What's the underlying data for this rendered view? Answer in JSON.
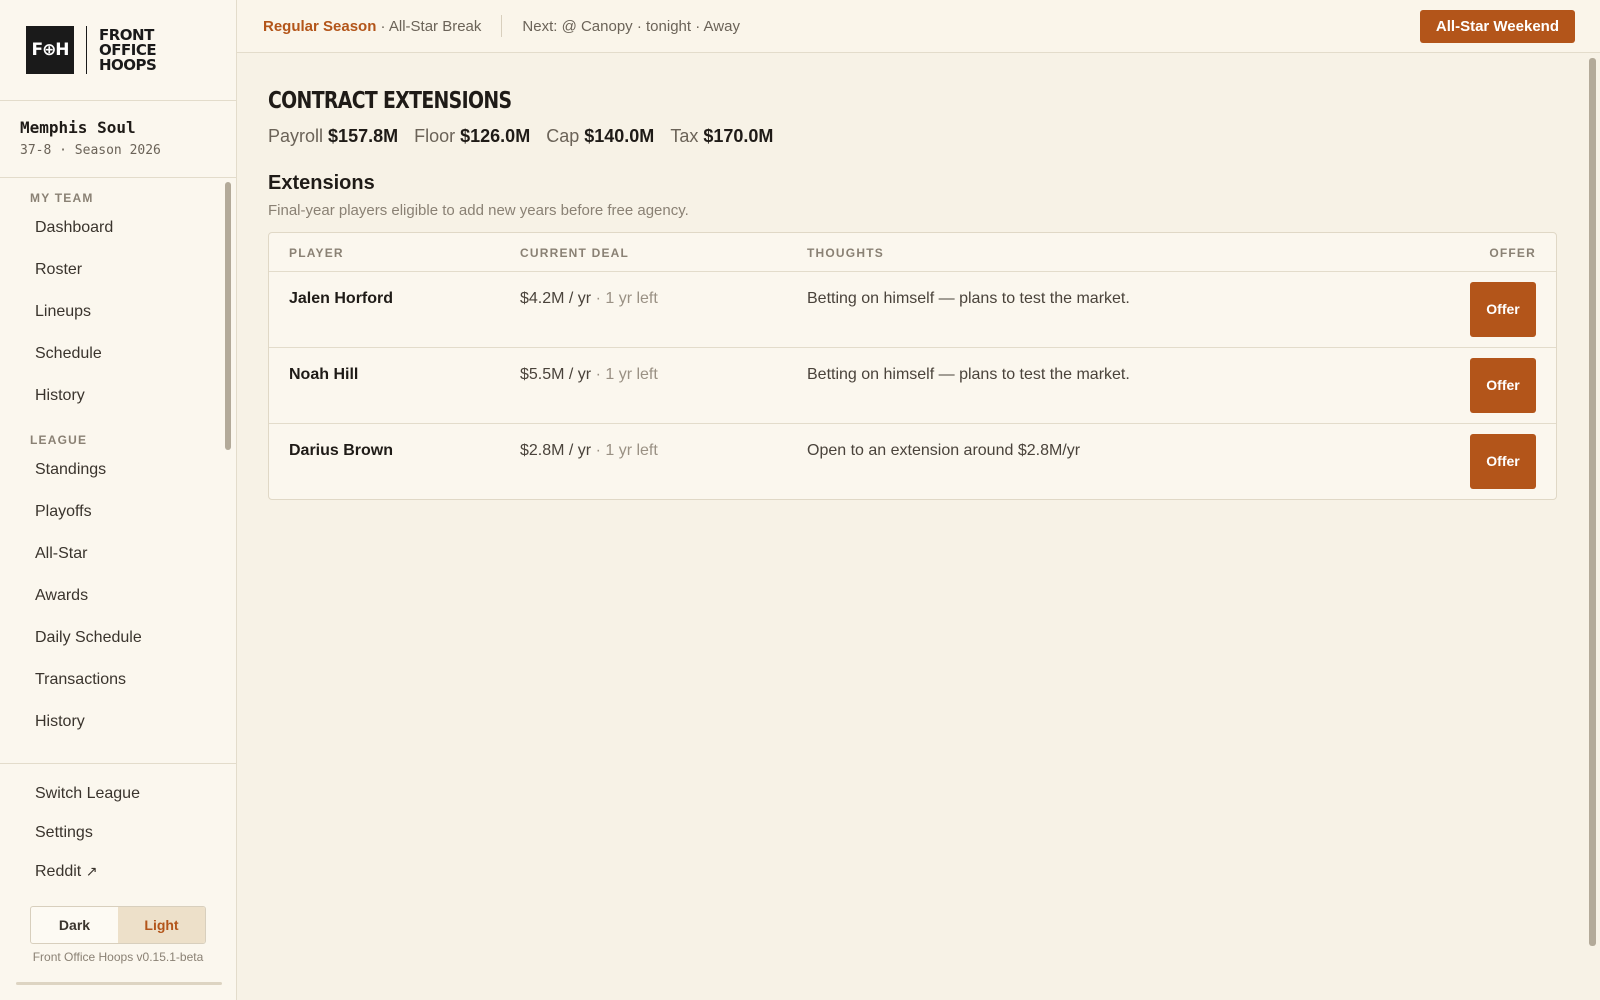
{
  "logo": {
    "mark": "F⊕H",
    "words": [
      "FRONT",
      "OFFICE",
      "HOOPS"
    ]
  },
  "team": {
    "name": "Memphis Soul",
    "record": "37-8 · Season 2026"
  },
  "sidebar": {
    "my_team_label": "MY TEAM",
    "my_team_items": [
      "Dashboard",
      "Roster",
      "Lineups",
      "Schedule",
      "History"
    ],
    "league_label": "LEAGUE",
    "league_items": [
      "Standings",
      "Playoffs",
      "All-Star",
      "Awards",
      "Daily Schedule",
      "Transactions",
      "History"
    ],
    "bottom_items": [
      "Switch League",
      "Settings",
      "Reddit"
    ],
    "external_arrow": "↗",
    "theme": {
      "dark": "Dark",
      "light": "Light",
      "selected": "Light"
    },
    "version": "Front Office Hoops v0.15.1-beta"
  },
  "topbar": {
    "season": "Regular Season",
    "phase": " · All-Star Break",
    "next_game": "Next: @ Canopy · tonight · Away",
    "action_button": "All-Star Weekend"
  },
  "main": {
    "page_title": "CONTRACT EXTENSIONS",
    "cap": [
      {
        "label": "Payroll",
        "value": "$157.8M"
      },
      {
        "label": "Floor",
        "value": "$126.0M"
      },
      {
        "label": "Cap",
        "value": "$140.0M"
      },
      {
        "label": "Tax",
        "value": "$170.0M"
      }
    ],
    "section_title": "Extensions",
    "section_subtitle": "Final-year players eligible to add new years before free agency.",
    "table": {
      "headers": {
        "player": "PLAYER",
        "deal": "CURRENT DEAL",
        "thoughts": "THOUGHTS",
        "offer": "OFFER"
      },
      "rows": [
        {
          "player": "Jalen Horford",
          "salary": "$4.2M / yr",
          "years": " · 1 yr left",
          "thoughts": "Betting on himself — plans to test the market.",
          "action": "Offer"
        },
        {
          "player": "Noah Hill",
          "salary": "$5.5M / yr",
          "years": " · 1 yr left",
          "thoughts": "Betting on himself — plans to test the market.",
          "action": "Offer"
        },
        {
          "player": "Darius Brown",
          "salary": "$2.8M / yr",
          "years": " · 1 yr left",
          "thoughts": "Open to an extension around $2.8M/yr",
          "action": "Offer"
        }
      ]
    }
  },
  "colors": {
    "accent": "#b3551a",
    "background": "#f7f2e6",
    "sidebar": "#fbf7ee"
  }
}
